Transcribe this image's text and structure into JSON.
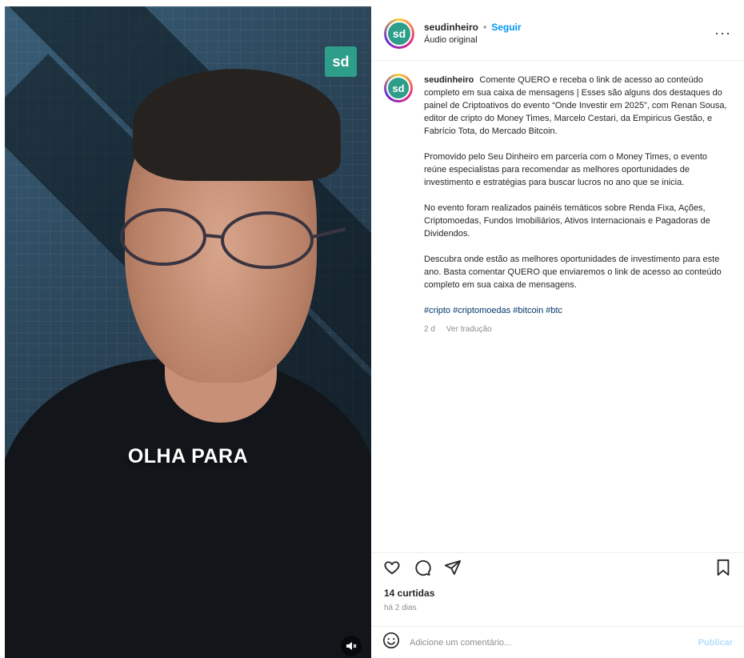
{
  "video": {
    "logo": "sd",
    "caption": "OLHA PARA"
  },
  "header": {
    "avatar": "sd",
    "username": "seudinheiro",
    "separator": "•",
    "follow": "Seguir",
    "audio": "Áudio original",
    "more": "···"
  },
  "post": {
    "avatar": "sd",
    "username": "seudinheiro",
    "p1": "Comente QUERO e receba o link de acesso ao conteúdo completo em sua caixa de mensagens | Esses são alguns dos destaques do painel de Criptoativos do evento “Onde Investir em 2025”, com Renan Sousa, editor de cripto do Money Times, Marcelo Cestari, da Empiricus Gestão, e Fabrício Tota, do Mercado Bitcoin.",
    "p2": "Promovido pelo Seu Dinheiro em parceria com o Money Times, o evento reúne especialistas para recomendar as melhores oportunidades de investimento e estratégias para buscar lucros no ano que se inicia.",
    "p3": "No evento foram realizados painéis temáticos sobre Renda Fixa, Ações, Criptomoedas, Fundos Imobiliários, Ativos Internacionais e Pagadoras de Dividendos.",
    "p4": "Descubra onde estão as melhores oportunidades de investimento para este ano. Basta comentar QUERO que enviaremos o link de acesso ao conteúdo completo em sua caixa de mensagens.",
    "hashtags": "#cripto #criptomoedas #bitcoin #btc",
    "time": "2 d",
    "translate": "Ver tradução"
  },
  "footer": {
    "likes": "14 curtidas",
    "ago": "há 2 dias",
    "comment_placeholder": "Adicione um comentário...",
    "publish": "Publicar"
  },
  "colors": {
    "accent": "#0095f6",
    "brand": "#2e9e8a"
  }
}
